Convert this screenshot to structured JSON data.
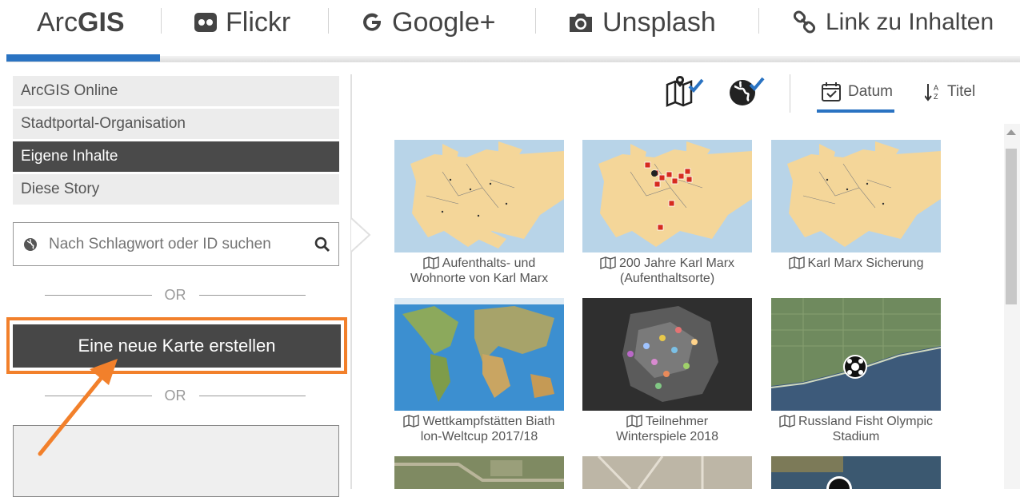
{
  "tabs": {
    "arcgis": {
      "pre": "Arc",
      "bold": "GIS"
    },
    "flickr": "Flickr",
    "google": "Google+",
    "unsplash": "Unsplash",
    "link": "Link zu Inhalten"
  },
  "left_menu": [
    "ArcGIS Online",
    "Stadtportal-Organisation",
    "Eigene Inhalte",
    "Diese Story"
  ],
  "search": {
    "placeholder": "Nach Schlagwort oder ID suchen"
  },
  "or_label": "OR",
  "create_button": "Eine neue Karte erstellen",
  "sort": {
    "date": "Datum",
    "title": "Titel"
  },
  "cards": [
    {
      "line1": "Aufenthalts- und",
      "line2": "Wohnorte von Karl Marx"
    },
    {
      "line1": "200 Jahre Karl Marx",
      "line2": "(Aufenthaltsorte)"
    },
    {
      "line1": "Karl Marx Sicherung",
      "line2": ""
    },
    {
      "line1": "Wettkampfstätten Biath",
      "line2": "lon-Weltcup 2017/18"
    },
    {
      "line1": "Teilnehmer",
      "line2": "Winterspiele 2018"
    },
    {
      "line1": "Russland Fisht Olympic",
      "line2": "Stadium"
    }
  ],
  "colors": {
    "accent": "#2a73c2",
    "highlight": "#f2802b",
    "active_bg": "#4a4a4a"
  },
  "icons": [
    "map-icon",
    "globe-icon",
    "calendar-icon",
    "sort-alpha-icon",
    "search-icon",
    "flickr-icon",
    "google-icon",
    "camera-icon",
    "link-icon"
  ]
}
